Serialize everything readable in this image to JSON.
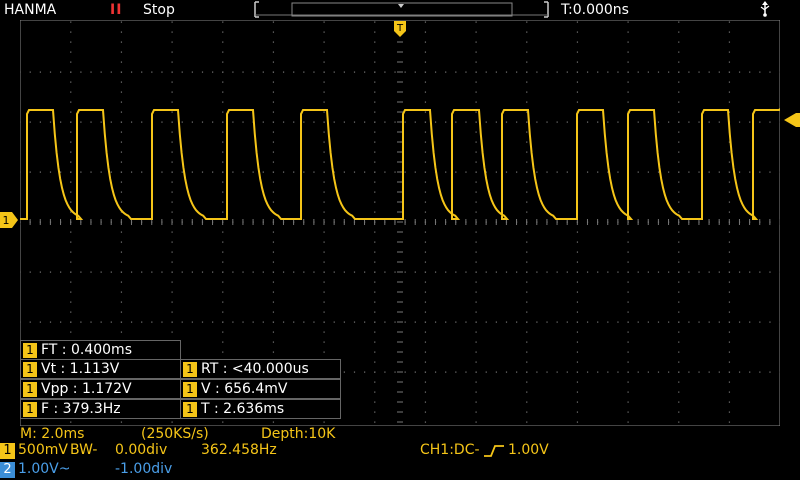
{
  "header": {
    "brand": "HANMA",
    "run_icon": "II",
    "run_state": "Stop",
    "trigger_time": "T:0.000ns",
    "usb_icon": "usb-icon"
  },
  "markers": {
    "trigger_marker": "T",
    "ch1_marker": "1"
  },
  "measurements": {
    "ft": "FT : 0.400ms",
    "vt": "Vt : 1.113V",
    "rt": "RT : <40.000us",
    "vpp": "Vpp : 1.172V",
    "v": "V : 656.4mV",
    "f": "F : 379.3Hz",
    "t": "T : 2.636ms",
    "ch": "1"
  },
  "status": {
    "timebase": "M: 2.0ms",
    "sample_rate": "(250KS/s)",
    "depth": "Depth:10K"
  },
  "ch1_row": {
    "badge": "1",
    "scale": "500mV",
    "bw": "BW-",
    "offset": "0.00div",
    "freq": "362.458Hz",
    "trigger": "CH1:DC-",
    "trigger_level": "1.00V"
  },
  "ch2_row": {
    "badge": "2",
    "scale": "1.00V~",
    "offset": "-1.00div"
  },
  "colors": {
    "ch1": "#f5c518",
    "ch2": "#3b8dd6",
    "grid": "#777777"
  }
}
